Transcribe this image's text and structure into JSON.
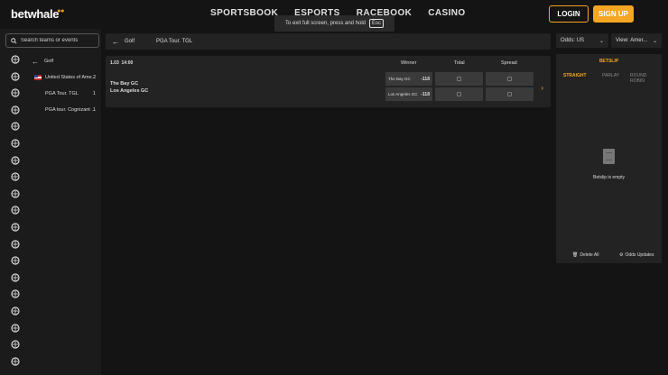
{
  "brand": {
    "name": "betwhale",
    "accent": "#f5a623"
  },
  "nav": {
    "items": [
      "SPORTSBOOK",
      "ESPORTS",
      "RACEBOOK",
      "CASINO"
    ]
  },
  "auth": {
    "login": "LOGIN",
    "signup": "SIGN UP"
  },
  "fullscreen_notice": {
    "text": "To exit full screen, press and hold",
    "key": "Esc"
  },
  "search": {
    "placeholder": "Search teams or events"
  },
  "sidebar": {
    "back_label": "Golf",
    "rows": [
      {
        "label": "United States of Ame...",
        "count": "2"
      },
      {
        "label": "PGA Tour. TGL",
        "count": "1"
      },
      {
        "label": "PGA tour. Cognizant ...",
        "count": "1"
      }
    ],
    "icons": [
      "football-icon",
      "soccer-icon",
      "basketball-icon",
      "tennis-icon",
      "baseball-icon",
      "hockey-icon",
      "golf-icon",
      "volleyball-icon",
      "boxing-icon",
      "mma-icon",
      "rugby-icon",
      "cricket-icon",
      "table-tennis-icon",
      "trophy-icon",
      "racing-icon",
      "athletics-icon",
      "esports-icon",
      "cycling-icon",
      "darts-icon"
    ]
  },
  "main": {
    "breadcrumb": "Golf",
    "league_title": "PGA Tour. TGL",
    "event": {
      "date": "1.03",
      "time": "14:00",
      "headers": {
        "winner": "Winner",
        "total": "Total",
        "spread": "Spread"
      },
      "teams": [
        "The Bay GC",
        "Los Angeles GC"
      ],
      "winner_odds": [
        {
          "team": "The Bay GC",
          "price": "-118"
        },
        {
          "team": "Los Angeles GC",
          "price": "-118"
        }
      ]
    }
  },
  "odds_format": {
    "label": "Odds:",
    "value": "US"
  },
  "view_select": {
    "label": "View:",
    "value": "Amer..."
  },
  "betslip": {
    "title": "BETSLIP",
    "tabs": [
      "STRAIGHT",
      "PARLAY",
      "ROUND ROBIN"
    ],
    "active_tab": "STRAIGHT",
    "empty_text": "Betslip is empty",
    "delete_all": "Delete All",
    "odds_updates": "Odds Updates"
  }
}
